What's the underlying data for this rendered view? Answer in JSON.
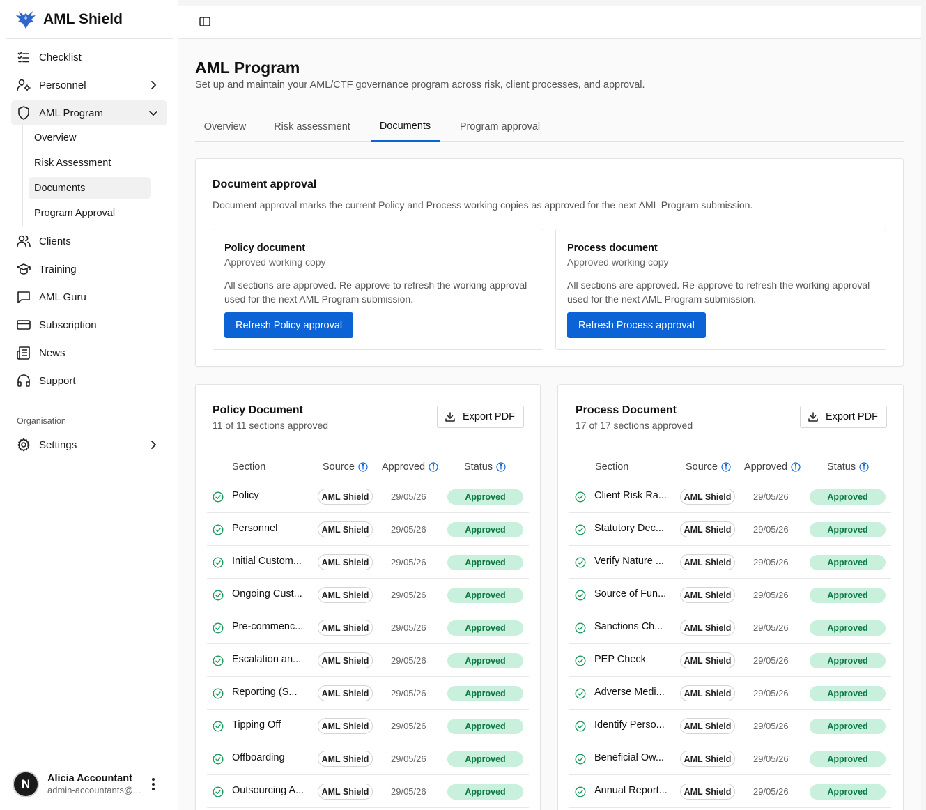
{
  "app": {
    "name": "AML Shield"
  },
  "sidebar": {
    "items": [
      {
        "label": "Checklist",
        "icon": "checklist-icon"
      },
      {
        "label": "Personnel",
        "icon": "user-cog-icon"
      },
      {
        "label": "AML Program",
        "icon": "shield-icon"
      },
      {
        "label": "Clients",
        "icon": "users-icon"
      },
      {
        "label": "Training",
        "icon": "graduation-cap-icon"
      },
      {
        "label": "AML Guru",
        "icon": "chat-icon"
      },
      {
        "label": "Subscription",
        "icon": "credit-card-icon"
      },
      {
        "label": "News",
        "icon": "newspaper-icon"
      },
      {
        "label": "Support",
        "icon": "headphones-icon"
      }
    ],
    "subitems": [
      "Overview",
      "Risk Assessment",
      "Documents",
      "Program Approval"
    ],
    "section_label": "Organisation",
    "settings_label": "Settings",
    "user": {
      "initial": "N",
      "name": "Alicia Accountant",
      "email": "admin-accountants@..."
    }
  },
  "page": {
    "title": "AML Program",
    "subtitle": "Set up and maintain your AML/CTF governance program across risk, client processes, and approval.",
    "tabs": [
      "Overview",
      "Risk assessment",
      "Documents",
      "Program approval"
    ],
    "active_tab": "Documents"
  },
  "approval": {
    "title": "Document approval",
    "description": "Document approval marks the current Policy and Process working copies as approved for the next AML Program submission.",
    "policy": {
      "title": "Policy document",
      "subtitle": "Approved working copy",
      "text": "All sections are approved. Re-approve to refresh the working approval used for the next AML Program submission.",
      "button": "Refresh Policy approval"
    },
    "process": {
      "title": "Process document",
      "subtitle": "Approved working copy",
      "text": "All sections are approved. Re-approve to refresh the working approval used for the next AML Program submission.",
      "button": "Refresh Process approval"
    }
  },
  "policy_doc": {
    "title": "Policy Document",
    "subtitle": "11 of 11 sections approved",
    "export_label": "Export PDF",
    "columns": [
      "Section",
      "Source",
      "Approved",
      "Status"
    ],
    "rows": [
      {
        "section": "Policy",
        "source": "AML Shield",
        "approved": "29/05/26",
        "status": "Approved"
      },
      {
        "section": "Personnel",
        "source": "AML Shield",
        "approved": "29/05/26",
        "status": "Approved"
      },
      {
        "section": "Initial Custom...",
        "source": "AML Shield",
        "approved": "29/05/26",
        "status": "Approved"
      },
      {
        "section": "Ongoing Cust...",
        "source": "AML Shield",
        "approved": "29/05/26",
        "status": "Approved"
      },
      {
        "section": "Pre-commenc...",
        "source": "AML Shield",
        "approved": "29/05/26",
        "status": "Approved"
      },
      {
        "section": "Escalation an...",
        "source": "AML Shield",
        "approved": "29/05/26",
        "status": "Approved"
      },
      {
        "section": "Reporting (S...",
        "source": "AML Shield",
        "approved": "29/05/26",
        "status": "Approved"
      },
      {
        "section": "Tipping Off",
        "source": "AML Shield",
        "approved": "29/05/26",
        "status": "Approved"
      },
      {
        "section": "Offboarding",
        "source": "AML Shield",
        "approved": "29/05/26",
        "status": "Approved"
      },
      {
        "section": "Outsourcing A...",
        "source": "AML Shield",
        "approved": "29/05/26",
        "status": "Approved"
      }
    ]
  },
  "process_doc": {
    "title": "Process Document",
    "subtitle": "17 of 17 sections approved",
    "export_label": "Export PDF",
    "columns": [
      "Section",
      "Source",
      "Approved",
      "Status"
    ],
    "rows": [
      {
        "section": "Client Risk Ra...",
        "source": "AML Shield",
        "approved": "29/05/26",
        "status": "Approved"
      },
      {
        "section": "Statutory Dec...",
        "source": "AML Shield",
        "approved": "29/05/26",
        "status": "Approved"
      },
      {
        "section": "Verify Nature ...",
        "source": "AML Shield",
        "approved": "29/05/26",
        "status": "Approved"
      },
      {
        "section": "Source of Fun...",
        "source": "AML Shield",
        "approved": "29/05/26",
        "status": "Approved"
      },
      {
        "section": "Sanctions Ch...",
        "source": "AML Shield",
        "approved": "29/05/26",
        "status": "Approved"
      },
      {
        "section": "PEP Check",
        "source": "AML Shield",
        "approved": "29/05/26",
        "status": "Approved"
      },
      {
        "section": "Adverse Medi...",
        "source": "AML Shield",
        "approved": "29/05/26",
        "status": "Approved"
      },
      {
        "section": "Identify Perso...",
        "source": "AML Shield",
        "approved": "29/05/26",
        "status": "Approved"
      },
      {
        "section": "Beneficial Ow...",
        "source": "AML Shield",
        "approved": "29/05/26",
        "status": "Approved"
      },
      {
        "section": "Annual Report...",
        "source": "AML Shield",
        "approved": "29/05/26",
        "status": "Approved"
      }
    ]
  },
  "colors": {
    "accent": "#0b63d6",
    "approved_bg": "#c9f0dc",
    "approved_text": "#0e7a46",
    "check": "#1a9a5c"
  }
}
